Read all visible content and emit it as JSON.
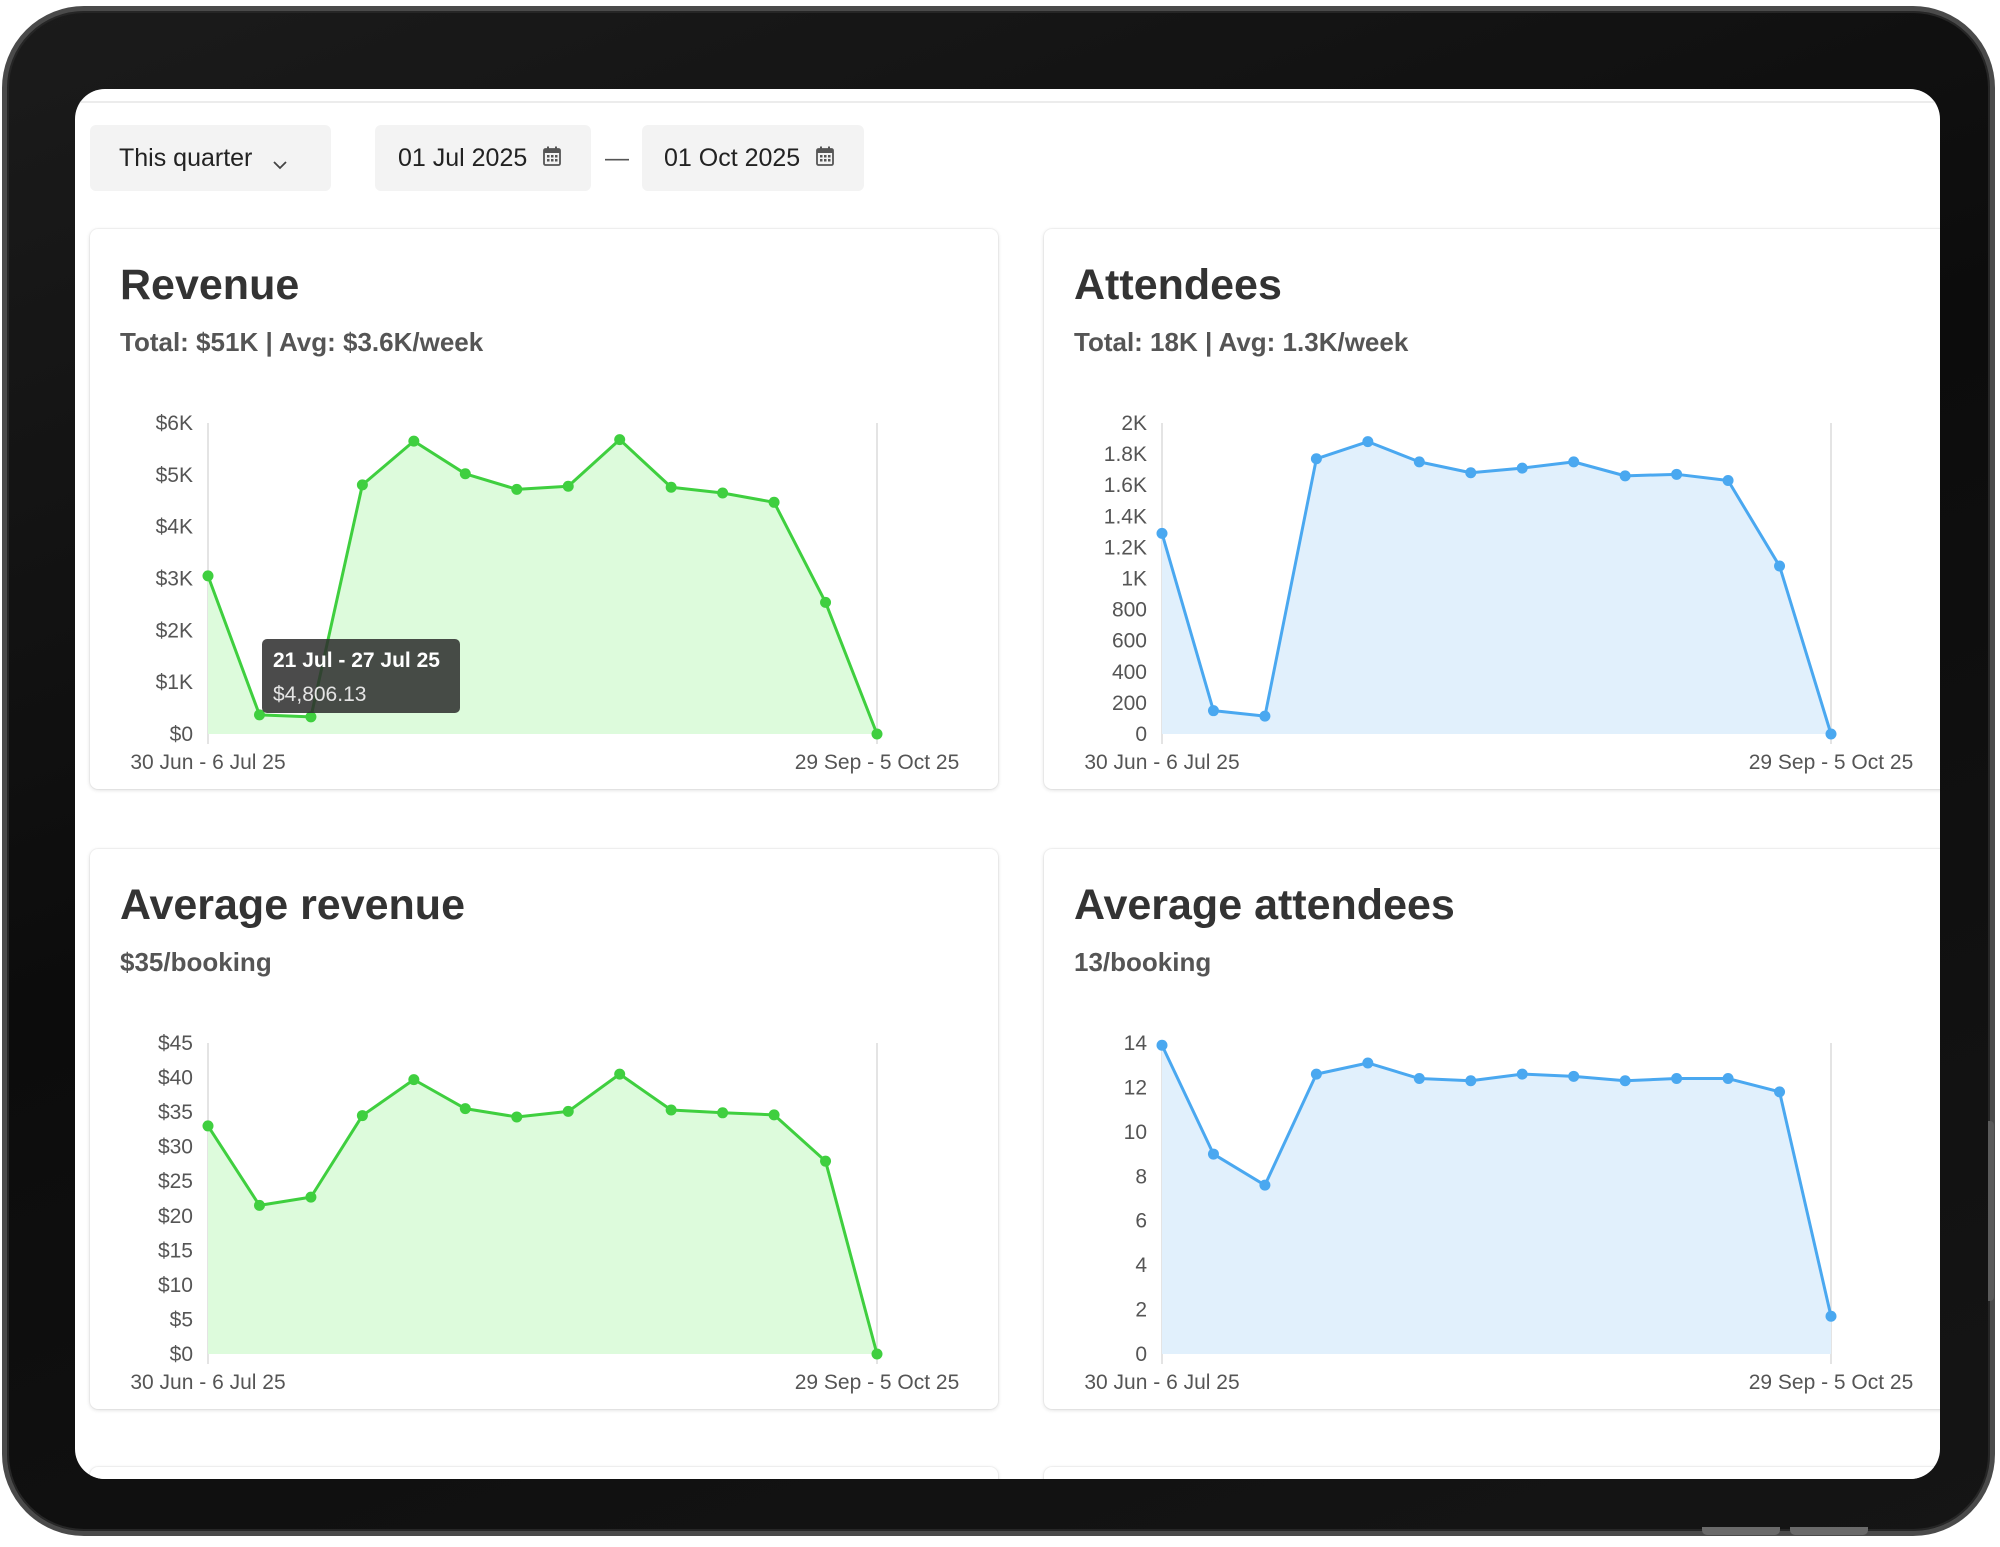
{
  "toolbar": {
    "period": "This quarter",
    "date_from": "01 Jul 2025",
    "date_separator": "—",
    "date_to": "01 Oct 2025"
  },
  "colors": {
    "green": "#3fcf3f",
    "green_fill": "#ddfbdc",
    "blue": "#4aa8f0",
    "blue_fill": "#e1f0fc"
  },
  "cards": {
    "revenue": {
      "title": "Revenue",
      "subtitle": "Total: $51K | Avg: $3.6K/week"
    },
    "attendees": {
      "title": "Attendees",
      "subtitle": "Total: 18K | Avg: 1.3K/week"
    },
    "avg_revenue": {
      "title": "Average revenue",
      "subtitle": "$35/booking"
    },
    "avg_attendees": {
      "title": "Average attendees",
      "subtitle": "13/booking"
    }
  },
  "tooltip": {
    "range": "21 Jul - 27 Jul 25",
    "value": "$4,806.13"
  },
  "chart_data": [
    {
      "id": "revenue",
      "type": "area",
      "color": "green",
      "x_first_label": "30 Jun - 6 Jul 25",
      "x_last_label": "29 Sep - 5 Oct 25",
      "ylim": [
        0,
        6000
      ],
      "y_ticks": [
        0,
        1000,
        2000,
        3000,
        4000,
        5000,
        6000
      ],
      "y_tick_labels": [
        "$0",
        "$1K",
        "$2K",
        "$3K",
        "$4K",
        "$5K",
        "$6K"
      ],
      "values": [
        3050,
        370,
        330,
        4806.13,
        5650,
        5020,
        4720,
        4780,
        5680,
        4760,
        4650,
        4470,
        2540,
        0
      ]
    },
    {
      "id": "attendees",
      "type": "area",
      "color": "blue",
      "x_first_label": "30 Jun - 6 Jul 25",
      "x_last_label": "29 Sep - 5 Oct 25",
      "ylim": [
        0,
        2000
      ],
      "y_ticks": [
        0,
        200,
        400,
        600,
        800,
        1000,
        1200,
        1400,
        1600,
        1800,
        2000
      ],
      "y_tick_labels": [
        "0",
        "200",
        "400",
        "600",
        "800",
        "1K",
        "1.2K",
        "1.4K",
        "1.6K",
        "1.8K",
        "2K"
      ],
      "values": [
        1290,
        150,
        115,
        1770,
        1880,
        1750,
        1680,
        1710,
        1750,
        1660,
        1670,
        1630,
        1080,
        0
      ]
    },
    {
      "id": "avg_revenue",
      "type": "area",
      "color": "green",
      "x_first_label": "30 Jun - 6 Jul 25",
      "x_last_label": "29 Sep - 5 Oct 25",
      "ylim": [
        0,
        45
      ],
      "y_ticks": [
        0,
        5,
        10,
        15,
        20,
        25,
        30,
        35,
        40,
        45
      ],
      "y_tick_labels": [
        "$0",
        "$5",
        "$10",
        "$15",
        "$20",
        "$25",
        "$30",
        "$35",
        "$40",
        "$45"
      ],
      "values": [
        33.0,
        21.5,
        22.7,
        34.5,
        39.7,
        35.5,
        34.3,
        35.1,
        40.5,
        35.3,
        34.9,
        34.6,
        27.9,
        0
      ]
    },
    {
      "id": "avg_attendees",
      "type": "area",
      "color": "blue",
      "x_first_label": "30 Jun - 6 Jul 25",
      "x_last_label": "29 Sep - 5 Oct 25",
      "ylim": [
        0,
        14
      ],
      "y_ticks": [
        0,
        2,
        4,
        6,
        8,
        10,
        12,
        14
      ],
      "y_tick_labels": [
        "0",
        "2",
        "4",
        "6",
        "8",
        "10",
        "12",
        "14"
      ],
      "values": [
        13.9,
        9.0,
        7.6,
        12.6,
        13.1,
        12.4,
        12.3,
        12.6,
        12.5,
        12.3,
        12.4,
        12.4,
        11.8,
        1.7
      ]
    }
  ]
}
